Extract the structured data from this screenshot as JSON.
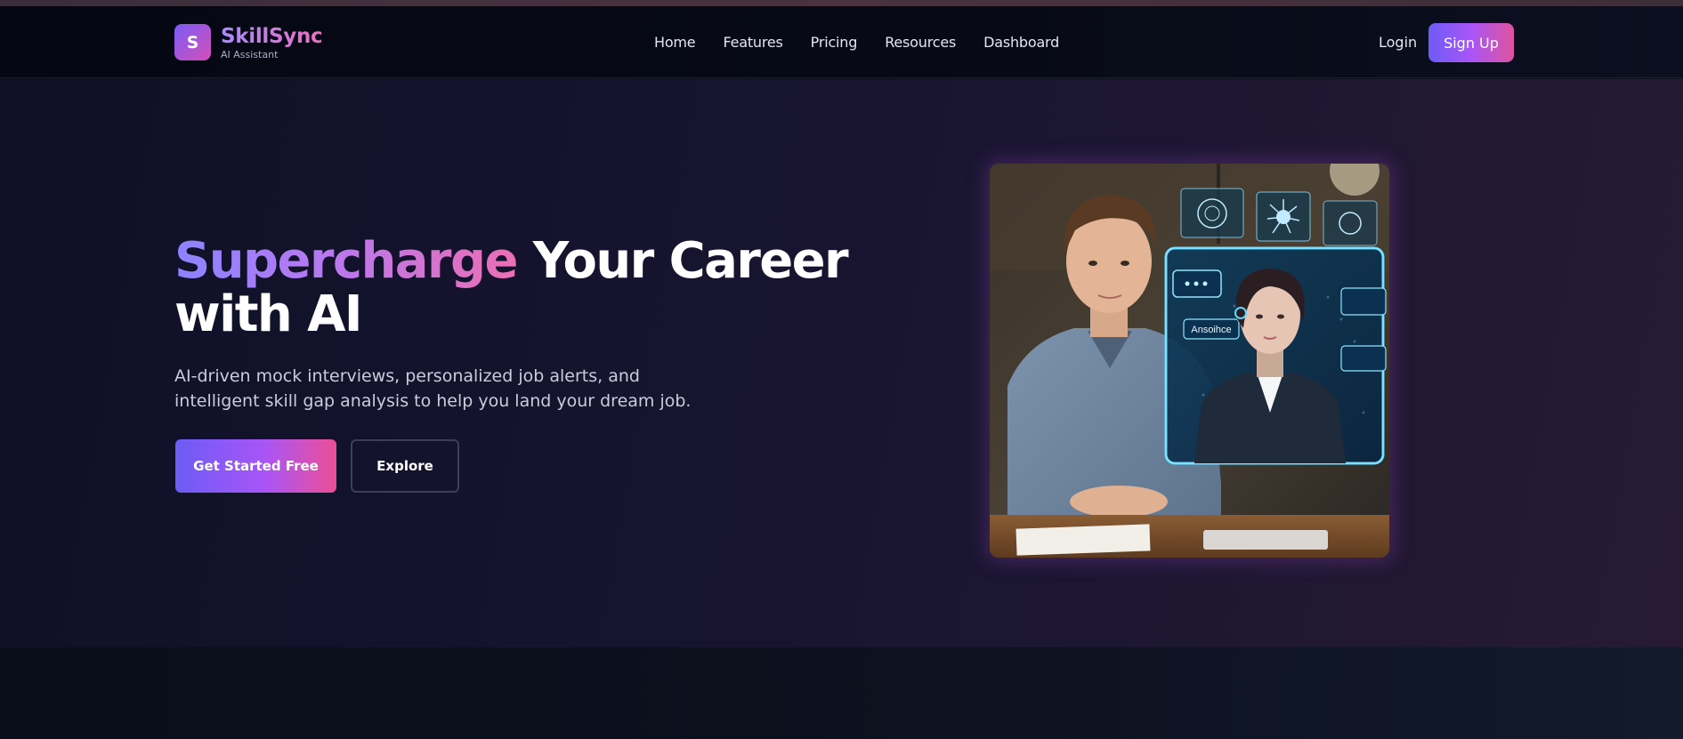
{
  "brand": {
    "logo_letter": "S",
    "name": "SkillSync",
    "tagline": "AI Assistant"
  },
  "nav": {
    "links": [
      "Home",
      "Features",
      "Pricing",
      "Resources",
      "Dashboard"
    ],
    "login_label": "Login",
    "signup_label": "Sign Up"
  },
  "hero": {
    "title_accent": "Supercharge",
    "title_rest": " Your Career with AI",
    "subtitle": "AI-driven mock interviews, personalized job alerts, and intelligent skill gap analysis to help you land your dream job.",
    "primary_cta": "Get Started Free",
    "secondary_cta": "Explore",
    "image": {
      "hologram_chip_label": "Ansoihce"
    }
  },
  "colors": {
    "accent_purple": "#a855f7",
    "accent_pink": "#ec4f94",
    "accent_indigo": "#6c5cf5",
    "hero_bg": "#15132e",
    "hologram_cyan": "#5fd8ff"
  }
}
